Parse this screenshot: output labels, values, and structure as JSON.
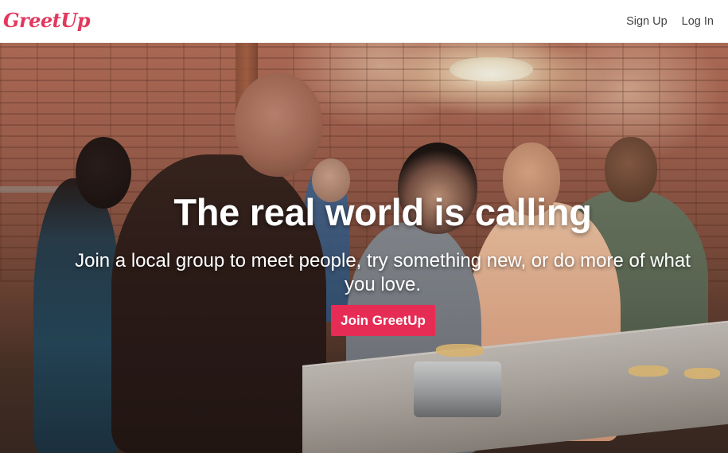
{
  "navbar": {
    "logo": "GreetUp",
    "links": [
      {
        "label": "Sign Up"
      },
      {
        "label": "Log In"
      }
    ]
  },
  "hero": {
    "headline": "The real world is calling",
    "subheadline": "Join a local group to meet people, try something new, or do more of what you love.",
    "cta_label": "Join GreetUp",
    "background_description": "photo"
  },
  "colors": {
    "brand": "#e3385e",
    "cta_background": "#e62c55",
    "nav_text": "#444444",
    "hero_text": "#ffffff"
  }
}
